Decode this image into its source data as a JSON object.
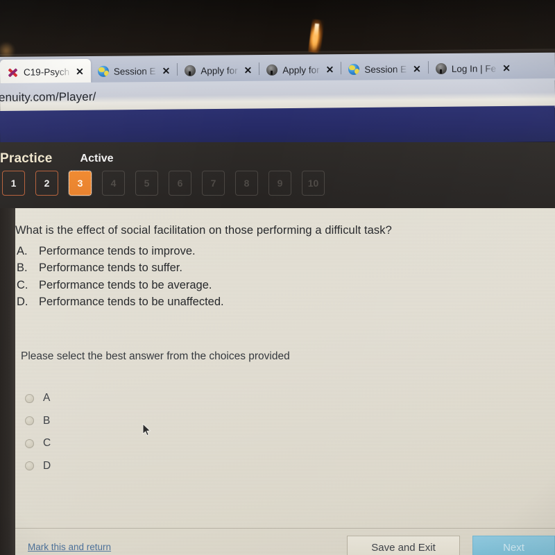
{
  "browser": {
    "url": "enuity.com/Player/",
    "tabs": [
      {
        "title": "C19-Psych",
        "favicon": "red-x-icon",
        "active": true
      },
      {
        "title": "Session E",
        "favicon": "globe-icon",
        "active": false
      },
      {
        "title": "Apply for",
        "favicon": "tree-icon",
        "active": false
      },
      {
        "title": "Apply for",
        "favicon": "tree-icon",
        "active": false
      },
      {
        "title": "Session E",
        "favicon": "globe-icon",
        "active": false
      },
      {
        "title": "Log In | Fe",
        "favicon": "tree-icon",
        "active": false
      }
    ],
    "close_glyph": "✕"
  },
  "toolbar": {
    "practice_label": "Practice",
    "status_label": "Active",
    "question_buttons": [
      {
        "number": "1",
        "state": "done"
      },
      {
        "number": "2",
        "state": "done"
      },
      {
        "number": "3",
        "state": "current"
      },
      {
        "number": "4",
        "state": "todo"
      },
      {
        "number": "5",
        "state": "todo"
      },
      {
        "number": "6",
        "state": "todo"
      },
      {
        "number": "7",
        "state": "todo"
      },
      {
        "number": "8",
        "state": "todo"
      },
      {
        "number": "9",
        "state": "todo"
      },
      {
        "number": "10",
        "state": "todo"
      }
    ],
    "accent_color": "#ef8a2e",
    "practice_color": "#efe5cc"
  },
  "question": {
    "stem": "What is the effect of social facilitation on those performing a difficult task?",
    "choices": [
      {
        "letter": "A.",
        "text": "Performance tends to improve."
      },
      {
        "letter": "B.",
        "text": "Performance tends to suffer."
      },
      {
        "letter": "C.",
        "text": "Performance tends to be average."
      },
      {
        "letter": "D.",
        "text": "Performance tends to be unaffected."
      }
    ],
    "prompt": "Please select the best answer from the choices provided",
    "radio_options": [
      {
        "label": "A",
        "selected": false
      },
      {
        "label": "B",
        "selected": false
      },
      {
        "label": "C",
        "selected": false
      },
      {
        "label": "D",
        "selected": false
      }
    ]
  },
  "footer": {
    "mark_link": "Mark this and return",
    "save_label": "Save and Exit",
    "next_label": "Next",
    "next_color": "#7cbdd4",
    "link_color": "#4a6f98"
  }
}
